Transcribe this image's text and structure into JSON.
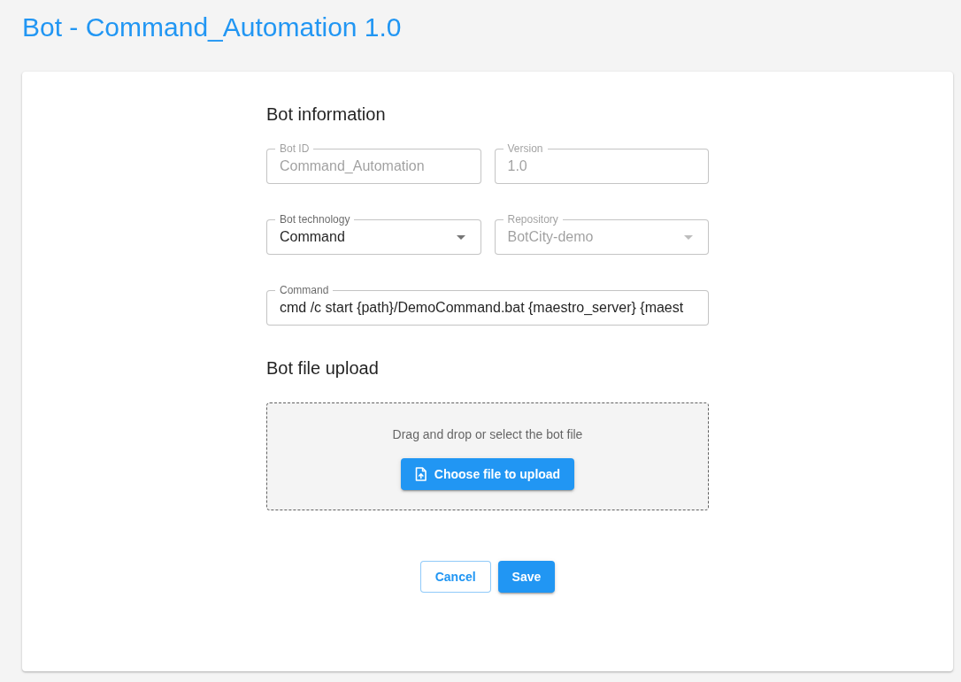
{
  "page_title": "Bot - Command_Automation 1.0",
  "bot_information": {
    "heading": "Bot information",
    "rows": [
      {
        "fields": [
          {
            "label": "Bot ID",
            "value": "Command_Automation",
            "kind": "text",
            "disabled": true
          },
          {
            "label": "Version",
            "value": "1.0",
            "kind": "text",
            "disabled": true
          }
        ]
      },
      {
        "fields": [
          {
            "label": "Bot technology",
            "value": "Command",
            "kind": "select",
            "disabled": false
          },
          {
            "label": "Repository",
            "value": "BotCity-demo",
            "kind": "select",
            "disabled": true
          }
        ]
      },
      {
        "fields": [
          {
            "label": "Command",
            "value": "cmd /c start {path}/DemoCommand.bat {maestro_server} {maest",
            "kind": "text",
            "disabled": false
          }
        ]
      }
    ]
  },
  "bot_file_upload": {
    "heading": "Bot file upload",
    "hint": "Drag and drop or select the bot file",
    "button": "Choose file to upload"
  },
  "actions": [
    {
      "label": "Cancel",
      "kind": "outlined"
    },
    {
      "label": "Save",
      "kind": "contained"
    }
  ]
}
